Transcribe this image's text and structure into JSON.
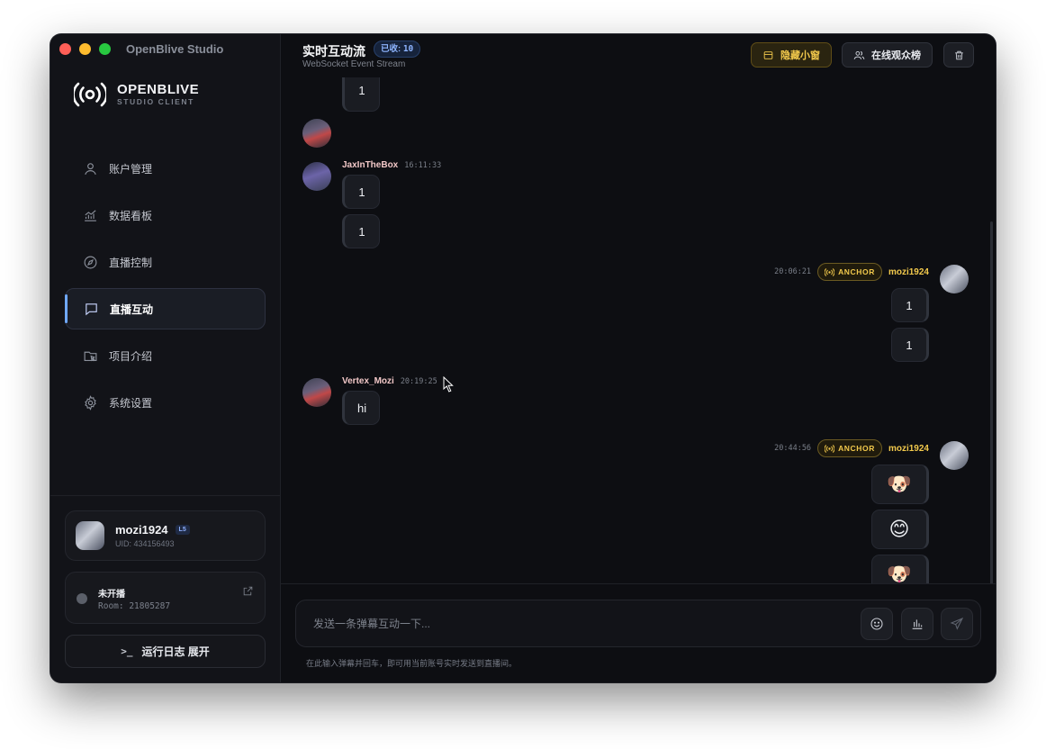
{
  "app": {
    "title": "OpenBlive Studio"
  },
  "brand": {
    "name": "OPENBLIVE",
    "subtitle": "STUDIO CLIENT"
  },
  "sidebar": {
    "items": [
      {
        "label": "账户管理",
        "icon": "user-icon",
        "active": false
      },
      {
        "label": "数据看板",
        "icon": "chart-line-icon",
        "active": false
      },
      {
        "label": "直播控制",
        "icon": "compass-icon",
        "active": false
      },
      {
        "label": "直播互动",
        "icon": "chat-bubble-icon",
        "active": true
      },
      {
        "label": "项目介绍",
        "icon": "folder-pointer-icon",
        "active": false
      },
      {
        "label": "系统设置",
        "icon": "gear-icon",
        "active": false
      }
    ]
  },
  "user": {
    "name": "mozi1924",
    "level": "L5",
    "uid": "UID: 434156493"
  },
  "live": {
    "status": "未开播",
    "room": "Room: 21805287"
  },
  "log_button": {
    "prompt": ">_",
    "label": "运行日志 展开"
  },
  "header": {
    "title": "实时互动流",
    "badge_label": "已收:",
    "badge_count": "10",
    "subtitle": "WebSocket Event Stream",
    "hide_button": "隐藏小窗",
    "rank_button": "在线观众榜"
  },
  "messages": [
    {
      "side": "left",
      "user": "",
      "time": "",
      "bubbles": [
        "1"
      ]
    },
    {
      "side": "left",
      "user": "JaxInTheBox",
      "time": "16:11:33",
      "bubbles": [
        "1",
        "1"
      ]
    },
    {
      "side": "right",
      "user": "mozi1924",
      "tag": "ANCHOR",
      "time": "20:06:21",
      "bubbles": [
        "1",
        "1"
      ]
    },
    {
      "side": "left",
      "user": "Vertex_Mozi",
      "time": "20:19:25",
      "bubbles": [
        "hi"
      ]
    },
    {
      "side": "right",
      "user": "mozi1924",
      "tag": "ANCHOR",
      "time": "20:44:56",
      "bubbles": [
        "🐶",
        "😊",
        "🐶"
      ]
    }
  ],
  "input": {
    "placeholder": "发送一条弹幕互动一下...",
    "hint": "在此输入弹幕并回车，即可用当前账号实时发送到直播间。"
  },
  "colors": {
    "accent": "#6fa8ff",
    "anchor": "#f2c94c",
    "background": "#0d0e12"
  }
}
